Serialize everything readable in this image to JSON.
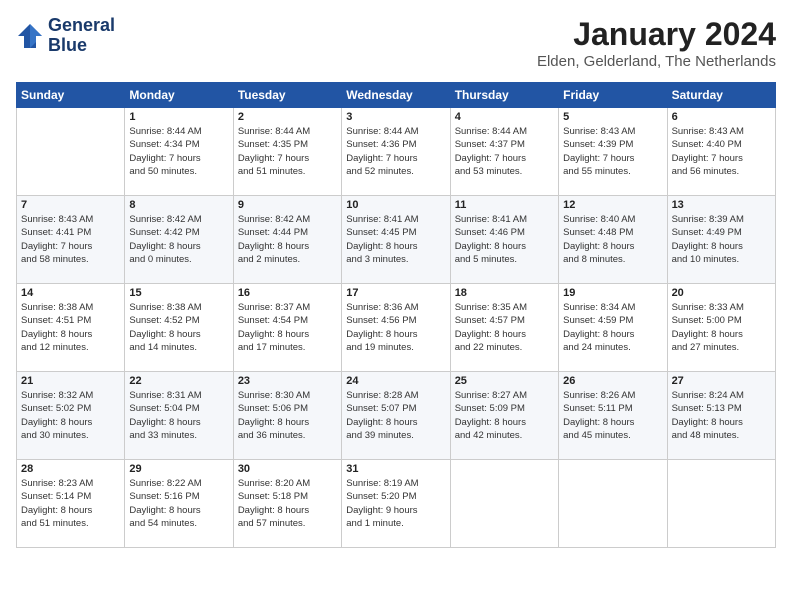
{
  "header": {
    "logo_line1": "General",
    "logo_line2": "Blue",
    "month": "January 2024",
    "location": "Elden, Gelderland, The Netherlands"
  },
  "days_of_week": [
    "Sunday",
    "Monday",
    "Tuesday",
    "Wednesday",
    "Thursday",
    "Friday",
    "Saturday"
  ],
  "weeks": [
    [
      {
        "day": "",
        "info": ""
      },
      {
        "day": "1",
        "info": "Sunrise: 8:44 AM\nSunset: 4:34 PM\nDaylight: 7 hours\nand 50 minutes."
      },
      {
        "day": "2",
        "info": "Sunrise: 8:44 AM\nSunset: 4:35 PM\nDaylight: 7 hours\nand 51 minutes."
      },
      {
        "day": "3",
        "info": "Sunrise: 8:44 AM\nSunset: 4:36 PM\nDaylight: 7 hours\nand 52 minutes."
      },
      {
        "day": "4",
        "info": "Sunrise: 8:44 AM\nSunset: 4:37 PM\nDaylight: 7 hours\nand 53 minutes."
      },
      {
        "day": "5",
        "info": "Sunrise: 8:43 AM\nSunset: 4:39 PM\nDaylight: 7 hours\nand 55 minutes."
      },
      {
        "day": "6",
        "info": "Sunrise: 8:43 AM\nSunset: 4:40 PM\nDaylight: 7 hours\nand 56 minutes."
      }
    ],
    [
      {
        "day": "7",
        "info": "Sunrise: 8:43 AM\nSunset: 4:41 PM\nDaylight: 7 hours\nand 58 minutes."
      },
      {
        "day": "8",
        "info": "Sunrise: 8:42 AM\nSunset: 4:42 PM\nDaylight: 8 hours\nand 0 minutes."
      },
      {
        "day": "9",
        "info": "Sunrise: 8:42 AM\nSunset: 4:44 PM\nDaylight: 8 hours\nand 2 minutes."
      },
      {
        "day": "10",
        "info": "Sunrise: 8:41 AM\nSunset: 4:45 PM\nDaylight: 8 hours\nand 3 minutes."
      },
      {
        "day": "11",
        "info": "Sunrise: 8:41 AM\nSunset: 4:46 PM\nDaylight: 8 hours\nand 5 minutes."
      },
      {
        "day": "12",
        "info": "Sunrise: 8:40 AM\nSunset: 4:48 PM\nDaylight: 8 hours\nand 8 minutes."
      },
      {
        "day": "13",
        "info": "Sunrise: 8:39 AM\nSunset: 4:49 PM\nDaylight: 8 hours\nand 10 minutes."
      }
    ],
    [
      {
        "day": "14",
        "info": "Sunrise: 8:38 AM\nSunset: 4:51 PM\nDaylight: 8 hours\nand 12 minutes."
      },
      {
        "day": "15",
        "info": "Sunrise: 8:38 AM\nSunset: 4:52 PM\nDaylight: 8 hours\nand 14 minutes."
      },
      {
        "day": "16",
        "info": "Sunrise: 8:37 AM\nSunset: 4:54 PM\nDaylight: 8 hours\nand 17 minutes."
      },
      {
        "day": "17",
        "info": "Sunrise: 8:36 AM\nSunset: 4:56 PM\nDaylight: 8 hours\nand 19 minutes."
      },
      {
        "day": "18",
        "info": "Sunrise: 8:35 AM\nSunset: 4:57 PM\nDaylight: 8 hours\nand 22 minutes."
      },
      {
        "day": "19",
        "info": "Sunrise: 8:34 AM\nSunset: 4:59 PM\nDaylight: 8 hours\nand 24 minutes."
      },
      {
        "day": "20",
        "info": "Sunrise: 8:33 AM\nSunset: 5:00 PM\nDaylight: 8 hours\nand 27 minutes."
      }
    ],
    [
      {
        "day": "21",
        "info": "Sunrise: 8:32 AM\nSunset: 5:02 PM\nDaylight: 8 hours\nand 30 minutes."
      },
      {
        "day": "22",
        "info": "Sunrise: 8:31 AM\nSunset: 5:04 PM\nDaylight: 8 hours\nand 33 minutes."
      },
      {
        "day": "23",
        "info": "Sunrise: 8:30 AM\nSunset: 5:06 PM\nDaylight: 8 hours\nand 36 minutes."
      },
      {
        "day": "24",
        "info": "Sunrise: 8:28 AM\nSunset: 5:07 PM\nDaylight: 8 hours\nand 39 minutes."
      },
      {
        "day": "25",
        "info": "Sunrise: 8:27 AM\nSunset: 5:09 PM\nDaylight: 8 hours\nand 42 minutes."
      },
      {
        "day": "26",
        "info": "Sunrise: 8:26 AM\nSunset: 5:11 PM\nDaylight: 8 hours\nand 45 minutes."
      },
      {
        "day": "27",
        "info": "Sunrise: 8:24 AM\nSunset: 5:13 PM\nDaylight: 8 hours\nand 48 minutes."
      }
    ],
    [
      {
        "day": "28",
        "info": "Sunrise: 8:23 AM\nSunset: 5:14 PM\nDaylight: 8 hours\nand 51 minutes."
      },
      {
        "day": "29",
        "info": "Sunrise: 8:22 AM\nSunset: 5:16 PM\nDaylight: 8 hours\nand 54 minutes."
      },
      {
        "day": "30",
        "info": "Sunrise: 8:20 AM\nSunset: 5:18 PM\nDaylight: 8 hours\nand 57 minutes."
      },
      {
        "day": "31",
        "info": "Sunrise: 8:19 AM\nSunset: 5:20 PM\nDaylight: 9 hours\nand 1 minute."
      },
      {
        "day": "",
        "info": ""
      },
      {
        "day": "",
        "info": ""
      },
      {
        "day": "",
        "info": ""
      }
    ]
  ]
}
